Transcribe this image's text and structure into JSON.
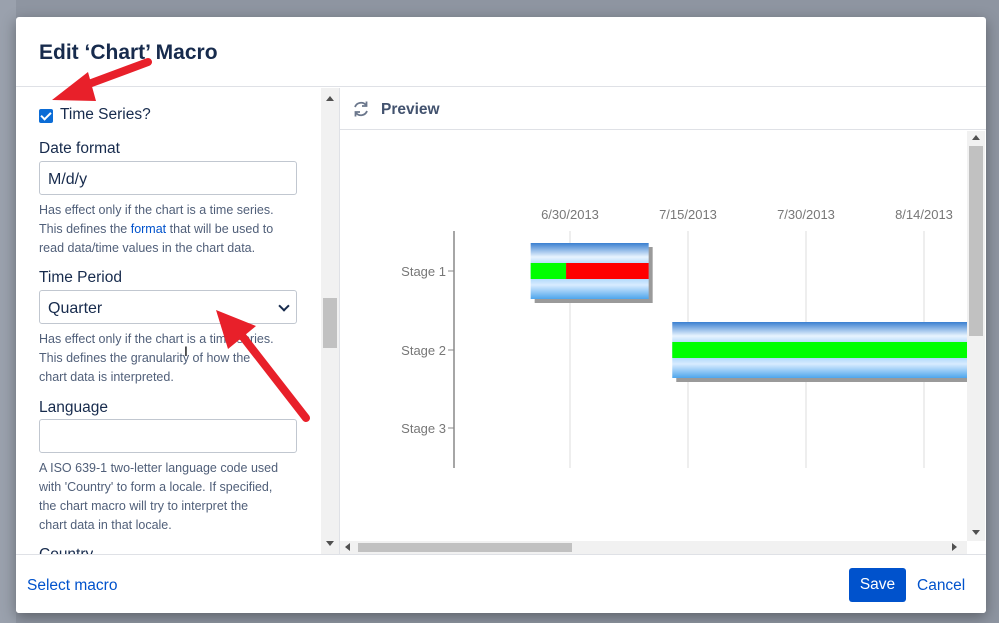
{
  "dialog": {
    "title": "Edit ‘Chart’ Macro"
  },
  "form": {
    "time_series_label": "Time Series?",
    "time_series_checked": true,
    "date_format": {
      "label": "Date format",
      "value": "M/d/y",
      "help_lines": [
        "Has effect only if the chart is a time series.",
        "This defines the ",
        "that will be used to",
        "read data/time values in the chart data."
      ],
      "help_link": "format"
    },
    "time_period": {
      "label": "Time Period",
      "selected": "Quarter",
      "help_lines": [
        "Has effect only if the chart is a time series.",
        "This defines the granularity of how the",
        "chart data is interpreted."
      ]
    },
    "language": {
      "label": "Language",
      "value": "",
      "help_lines": [
        "A ISO 639-1 two-letter language code used",
        "with 'Country' to form a locale. If specified,",
        "the chart macro will try to interpret the",
        "chart data in that locale."
      ]
    },
    "next_label_cut": "Country"
  },
  "preview": {
    "title": "Preview",
    "icon": "refresh-icon"
  },
  "chart_data": {
    "type": "gantt",
    "x_tick_labels": [
      "6/30/2013",
      "7/15/2013",
      "7/30/2013",
      "8/14/2013"
    ],
    "categories": [
      "Stage 1",
      "Stage 2",
      "Stage 3"
    ],
    "tasks": [
      {
        "category": "Stage 1",
        "start": "6/25/2013",
        "end": "7/10/2013",
        "percent_complete": 30
      },
      {
        "category": "Stage 2",
        "start": "7/13/2013",
        "end": "8/20/2013",
        "percent_complete": 100
      }
    ],
    "colors": {
      "bar": "#5aaef0",
      "complete": "#00ff00",
      "incomplete": "#ff0000",
      "grid": "#dddddd"
    }
  },
  "footer": {
    "select_macro": "Select macro",
    "save": "Save",
    "cancel": "Cancel"
  },
  "annotations": {
    "arrow_color": "#e8202a"
  }
}
